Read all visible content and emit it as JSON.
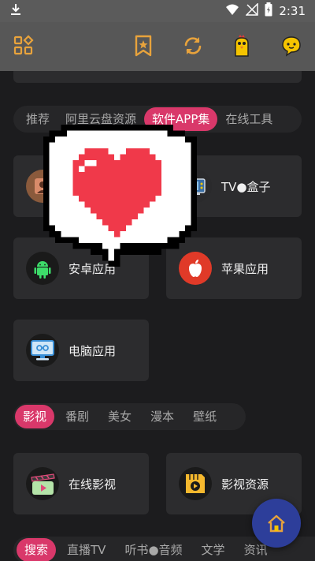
{
  "statusbar": {
    "time": "2:31"
  },
  "section1": {
    "tabs": [
      "推荐",
      "阿里云盘资源",
      "软件APP集",
      "在线工具"
    ],
    "active_tab": "软件APP集",
    "cards": [
      {
        "label": "",
        "icon": "person-app-icon"
      },
      {
        "label": "TV●盒子",
        "icon": "tv-icon"
      },
      {
        "label": "安卓应用",
        "icon": "android-icon"
      },
      {
        "label": "苹果应用",
        "icon": "apple-icon"
      },
      {
        "label": "电脑应用",
        "icon": "computer-icon"
      }
    ]
  },
  "section2": {
    "tabs": [
      "影视",
      "番剧",
      "美女",
      "漫本",
      "壁纸"
    ],
    "active_tab": "影视",
    "cards": [
      {
        "label": "在线影视",
        "icon": "clapperboard-icon"
      },
      {
        "label": "影视资源",
        "icon": "folder-play-icon"
      }
    ]
  },
  "section3": {
    "tabs": [
      "搜索",
      "直播TV",
      "听书●音频",
      "文学",
      "资讯"
    ],
    "active_tab": "搜索"
  },
  "colors": {
    "accent": "#d9386a",
    "topbar_icon": "#e8a33c",
    "fab": "#2d3e9a"
  },
  "overlay": {
    "icon": "pixel-heart-speech-bubble-icon"
  }
}
